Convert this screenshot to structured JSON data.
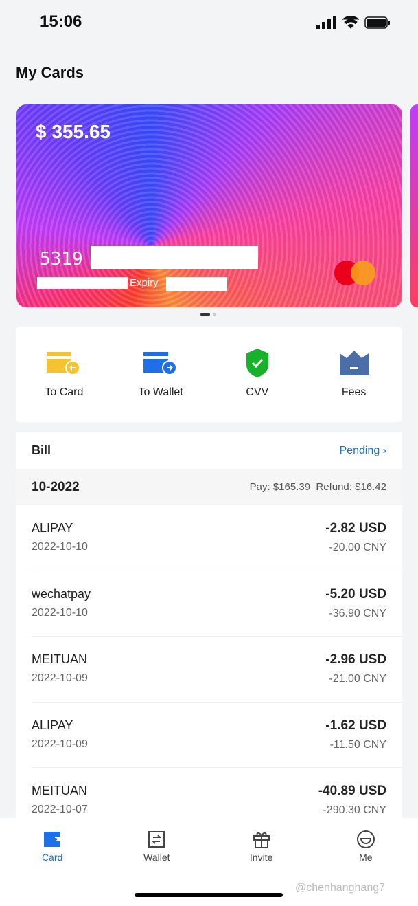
{
  "status": {
    "time": "15:06"
  },
  "title": "My Cards",
  "card": {
    "balance": "$ 355.65",
    "number_prefix": "5319",
    "expiry_label": "Expiry",
    "brand": "mastercard"
  },
  "actions": [
    {
      "label": "To Card",
      "icon": "card-in-icon",
      "color": "#f7c232"
    },
    {
      "label": "To Wallet",
      "icon": "card-out-icon",
      "color": "#1f6fe8"
    },
    {
      "label": "CVV",
      "icon": "shield-check-icon",
      "color": "#17b12a"
    },
    {
      "label": "Fees",
      "icon": "crown-icon",
      "color": "#4a6fa8"
    }
  ],
  "bill": {
    "title": "Bill",
    "pending": "Pending",
    "month": "10-2022",
    "pay": "Pay: $165.39",
    "refund": "Refund: $16.42",
    "rows": [
      {
        "merchant": "ALIPAY",
        "date": "2022-10-10",
        "usd": "-2.82 USD",
        "cny": "-20.00 CNY"
      },
      {
        "merchant": "wechatpay",
        "date": "2022-10-10",
        "usd": "-5.20 USD",
        "cny": "-36.90 CNY"
      },
      {
        "merchant": "MEITUAN",
        "date": "2022-10-09",
        "usd": "-2.96 USD",
        "cny": "-21.00 CNY"
      },
      {
        "merchant": "ALIPAY",
        "date": "2022-10-09",
        "usd": "-1.62 USD",
        "cny": "-11.50 CNY"
      },
      {
        "merchant": "MEITUAN",
        "date": "2022-10-07",
        "usd": "-40.89 USD",
        "cny": "-290.30 CNY"
      }
    ]
  },
  "tabs": [
    {
      "label": "Card",
      "active": true
    },
    {
      "label": "Wallet"
    },
    {
      "label": "Invite"
    },
    {
      "label": "Me"
    }
  ],
  "watermark": "@chenhanghang7",
  "colors": {
    "accent": "#1c6fd1"
  }
}
